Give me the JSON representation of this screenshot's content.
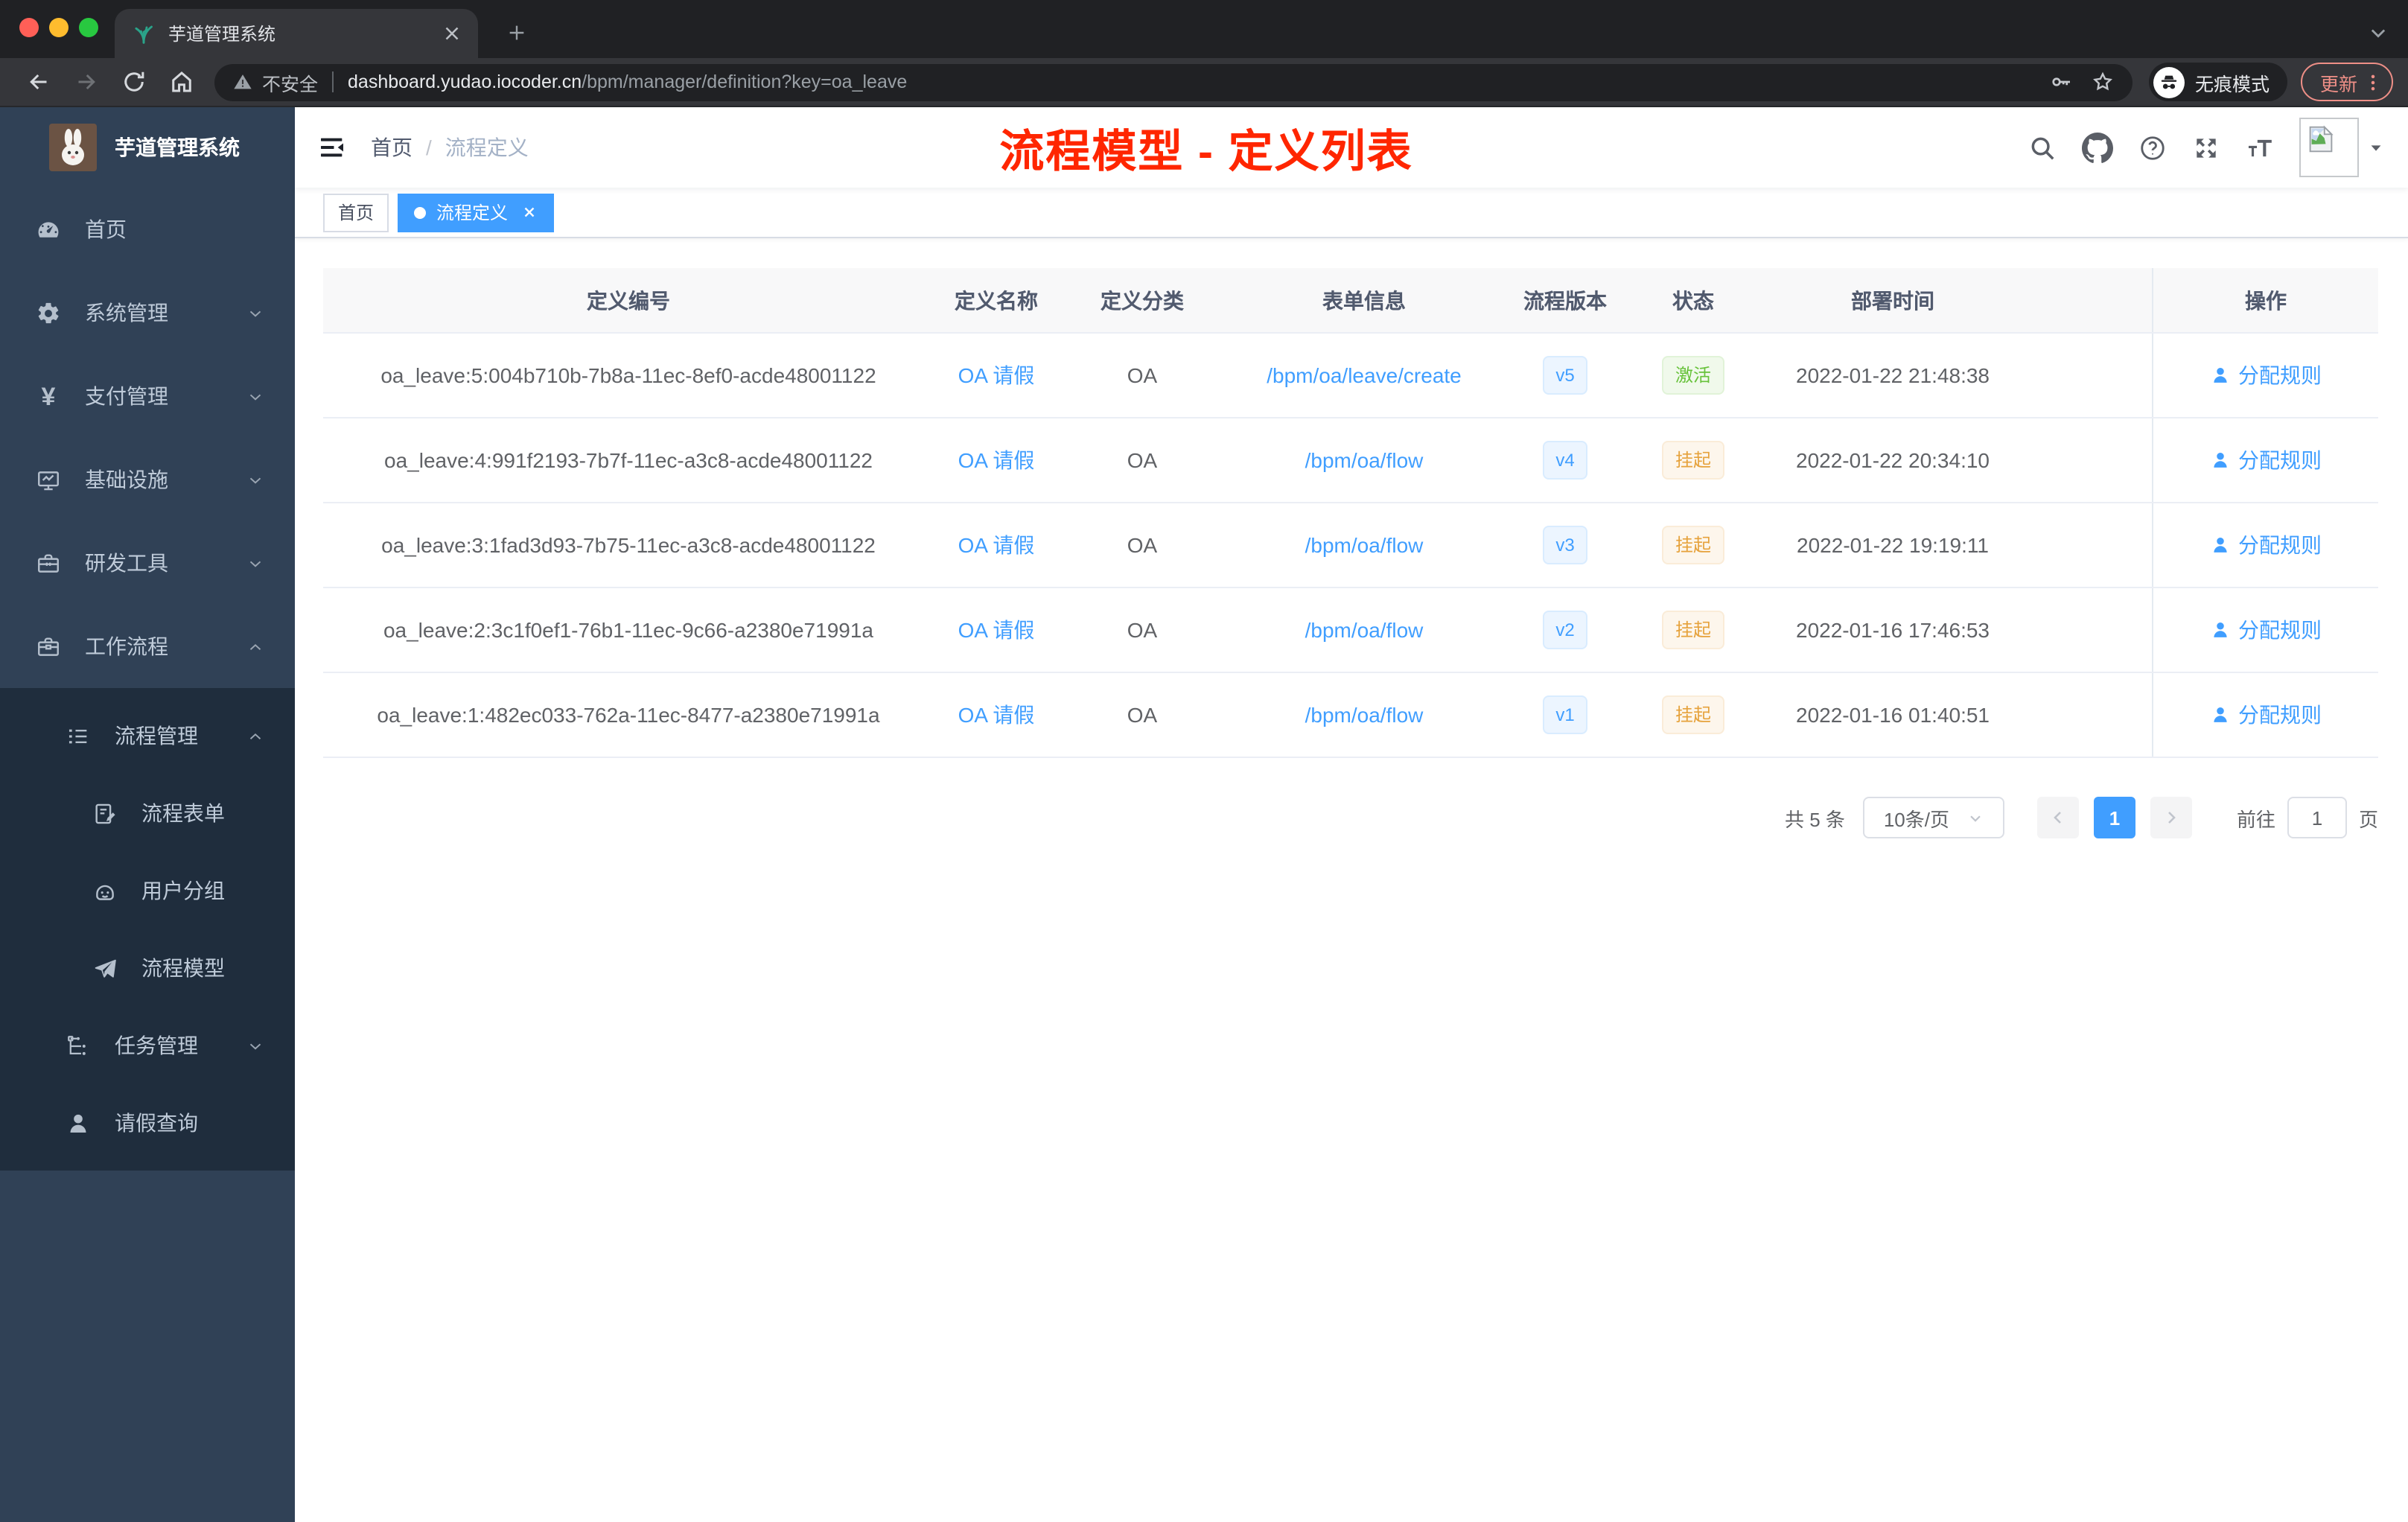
{
  "browser": {
    "tab_title": "芋道管理系统",
    "security_label": "不安全",
    "url_host": "dashboard.yudao.iocoder.cn",
    "url_path": "/bpm/manager/definition?key=oa_leave",
    "incognito_label": "无痕模式",
    "update_label": "更新"
  },
  "sidebar": {
    "brand": "芋道管理系统",
    "menu": [
      {
        "key": "home",
        "label": "首页",
        "icon": "dashboard-icon",
        "level": 0,
        "dark": false
      },
      {
        "key": "system",
        "label": "系统管理",
        "icon": "gear-icon",
        "level": 0,
        "chevron": "down",
        "dark": false
      },
      {
        "key": "payment",
        "label": "支付管理",
        "icon": "yen-icon",
        "level": 0,
        "chevron": "down",
        "dark": false
      },
      {
        "key": "infra",
        "label": "基础设施",
        "icon": "monitor-icon",
        "level": 0,
        "chevron": "down",
        "dark": false
      },
      {
        "key": "devtools",
        "label": "研发工具",
        "icon": "toolbox-icon",
        "level": 0,
        "chevron": "down",
        "dark": false
      },
      {
        "key": "workflow",
        "label": "工作流程",
        "icon": "briefcase-icon",
        "level": 0,
        "chevron": "up",
        "dark": false
      },
      {
        "key": "process-mgmt",
        "label": "流程管理",
        "icon": "list-tree-icon",
        "level": 1,
        "chevron": "up",
        "dark": true
      },
      {
        "key": "process-form",
        "label": "流程表单",
        "icon": "form-edit-icon",
        "level": 2,
        "dark": true
      },
      {
        "key": "user-group",
        "label": "用户分组",
        "icon": "robot-face-icon",
        "level": 2,
        "dark": true
      },
      {
        "key": "process-model",
        "label": "流程模型",
        "icon": "paper-plane-icon",
        "level": 2,
        "dark": true
      },
      {
        "key": "task-mgmt",
        "label": "任务管理",
        "icon": "org-tree-icon",
        "level": 1,
        "chevron": "down",
        "dark": true
      },
      {
        "key": "leave-query",
        "label": "请假查询",
        "icon": "person-icon",
        "level": 1,
        "dark": true
      }
    ]
  },
  "header": {
    "breadcrumb": [
      "首页",
      "流程定义"
    ],
    "breadcrumb_separator": "/",
    "annotation": "流程模型 - 定义列表"
  },
  "tags": [
    {
      "label": "首页",
      "active": false
    },
    {
      "label": "流程定义",
      "active": true
    }
  ],
  "table": {
    "columns": [
      "定义编号",
      "定义名称",
      "定义分类",
      "表单信息",
      "流程版本",
      "状态",
      "部署时间",
      "操作"
    ],
    "rows": [
      {
        "id": "oa_leave:5:004b710b-7b8a-11ec-8ef0-acde48001122",
        "name": "OA 请假",
        "category": "OA",
        "form": "/bpm/oa/leave/create",
        "version": "v5",
        "status": "激活",
        "status_type": "success",
        "time": "2022-01-22 21:48:38",
        "action": "分配规则"
      },
      {
        "id": "oa_leave:4:991f2193-7b7f-11ec-a3c8-acde48001122",
        "name": "OA 请假",
        "category": "OA",
        "form": "/bpm/oa/flow",
        "version": "v4",
        "status": "挂起",
        "status_type": "warning",
        "time": "2022-01-22 20:34:10",
        "action": "分配规则"
      },
      {
        "id": "oa_leave:3:1fad3d93-7b75-11ec-a3c8-acde48001122",
        "name": "OA 请假",
        "category": "OA",
        "form": "/bpm/oa/flow",
        "version": "v3",
        "status": "挂起",
        "status_type": "warning",
        "time": "2022-01-22 19:19:11",
        "action": "分配规则"
      },
      {
        "id": "oa_leave:2:3c1f0ef1-76b1-11ec-9c66-a2380e71991a",
        "name": "OA 请假",
        "category": "OA",
        "form": "/bpm/oa/flow",
        "version": "v2",
        "status": "挂起",
        "status_type": "warning",
        "time": "2022-01-16 17:46:53",
        "action": "分配规则"
      },
      {
        "id": "oa_leave:1:482ec033-762a-11ec-8477-a2380e71991a",
        "name": "OA 请假",
        "category": "OA",
        "form": "/bpm/oa/flow",
        "version": "v1",
        "status": "挂起",
        "status_type": "warning",
        "time": "2022-01-16 01:40:51",
        "action": "分配规则"
      }
    ]
  },
  "pagination": {
    "total": "共 5 条",
    "page_size": "10条/页",
    "current_page": "1",
    "goto_label": "前往",
    "goto_value": "1",
    "page_unit": "页"
  },
  "colors": {
    "accent": "#409eff",
    "success": "#67c23a",
    "warning": "#e6a23c",
    "annotation_red": "#ff2600",
    "sidebar_bg": "#304156",
    "submenu_bg": "#1f2d3d"
  }
}
